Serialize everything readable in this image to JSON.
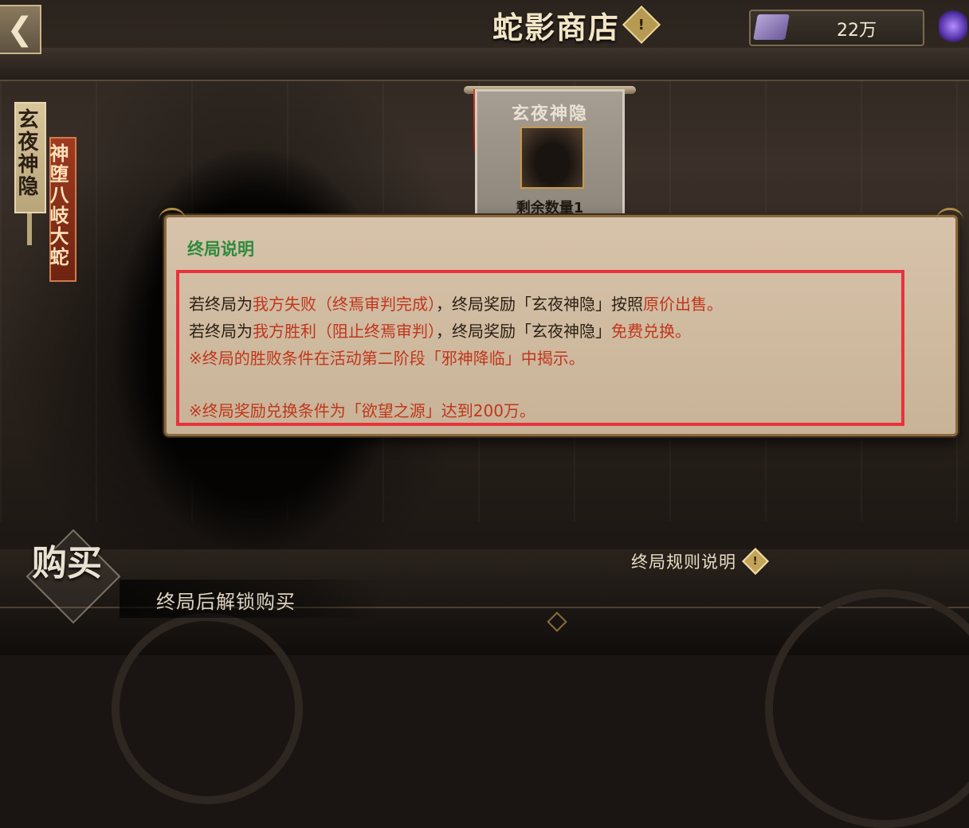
{
  "header": {
    "back_icon": "back-arrow-icon",
    "title": "蛇影商店",
    "help_symbol": "!",
    "currency_value": "22万"
  },
  "left_tabs": [
    {
      "label": "玄夜神隐"
    },
    {
      "label": "神堕八岐大蛇"
    }
  ],
  "shop_item": {
    "name": "玄夜神隐",
    "remaining": "剩余数量1"
  },
  "dialog": {
    "title": "终局说明",
    "line1": {
      "a": "若终局为",
      "b": "我方失败（终焉审判完成）",
      "c": "，终局奖励「玄夜神隐」按照",
      "d": "原价出售",
      "e": "。"
    },
    "line2": {
      "a": "若终局为",
      "b": "我方胜利（阻止终焉审判）",
      "c": "，终局奖励「玄夜神隐」",
      "d": "免费兑换",
      "e": "。"
    },
    "line3": "※终局的胜败条件在活动第二阶段「邪神降临」中揭示。",
    "line4": "※终局奖励兑换条件为「欲望之源」达到200万。"
  },
  "bottom": {
    "rule_link": "终局规则说明",
    "rule_symbol": "!",
    "buy_badge": "购买",
    "buy_status": "终局后解锁购买"
  },
  "colors": {
    "accent_red": "#c0361c",
    "title_green": "#2e8a3e",
    "highlight_border": "#e8323c"
  }
}
